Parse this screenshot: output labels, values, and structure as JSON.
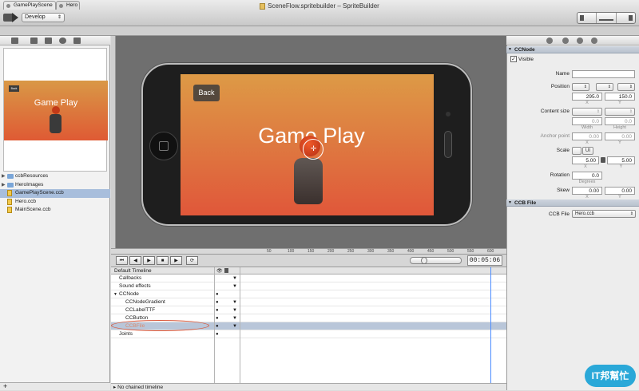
{
  "window": {
    "title": "SceneFlow.spritebuilder – SpriteBuilder"
  },
  "toolbar": {
    "target": "Develop"
  },
  "tabs": [
    {
      "label": "GamePlayScene"
    },
    {
      "label": "Hero"
    }
  ],
  "preview": {
    "back_label": "Back",
    "title": "Game Play"
  },
  "files": [
    {
      "label": "ccbResources",
      "kind": "folder"
    },
    {
      "label": "HeroImages",
      "kind": "folder"
    },
    {
      "label": "GamePlayScene.ccb",
      "kind": "ccb",
      "selected": true
    },
    {
      "label": "Hero.ccb",
      "kind": "ccb"
    },
    {
      "label": "MainScene.ccb",
      "kind": "ccb"
    }
  ],
  "stage": {
    "back_label": "Back",
    "title": "Game Play"
  },
  "ruler": {
    "ticks": [
      "50",
      "100",
      "150",
      "200",
      "250",
      "300",
      "350",
      "400",
      "450",
      "500",
      "550",
      "600",
      "650",
      "700",
      "750"
    ]
  },
  "timeline": {
    "timecode": "00:05:06",
    "header": "Default Timeline",
    "rows": [
      {
        "label": "Callbacks",
        "indent": 0
      },
      {
        "label": "Sound effects",
        "indent": 0
      },
      {
        "label": "CCNode",
        "indent": 0
      },
      {
        "label": "CCNodeGradient",
        "indent": 1
      },
      {
        "label": "CCLabelTTF",
        "indent": 1
      },
      {
        "label": "CCButton",
        "indent": 1
      },
      {
        "label": "CCBFile",
        "indent": 1,
        "selected": true
      },
      {
        "label": "Joints",
        "indent": 0
      }
    ],
    "chained": "No chained timeline"
  },
  "inspector": {
    "ccnode_header": "CCNode",
    "visible_label": "Visible",
    "name_label": "Name",
    "name_value": "",
    "position_label": "Position",
    "position_x": "295.0",
    "position_y": "150.0",
    "x_caption": "X",
    "y_caption": "Y",
    "content_size_label": "Content size",
    "content_w": "0.0",
    "content_h": "0.0",
    "width_caption": "Width",
    "height_caption": "Height",
    "anchor_label": "Anchor point",
    "anchor_x": "0.00",
    "anchor_y": "0.00",
    "scale_label": "Scale",
    "scale_ui": "UI",
    "scale_x": "5.00",
    "scale_y": "5.00",
    "rotation_label": "Rotation",
    "rotation_value": "0.0",
    "degrees_caption": "Degrees",
    "skew_label": "Skew",
    "skew_x": "0.00",
    "skew_y": "0.00",
    "ccbfile_header": "CCB File",
    "ccbfile_label": "CCB File",
    "ccbfile_value": "Hero.ccb"
  },
  "watermark": "IT邦幫忙"
}
